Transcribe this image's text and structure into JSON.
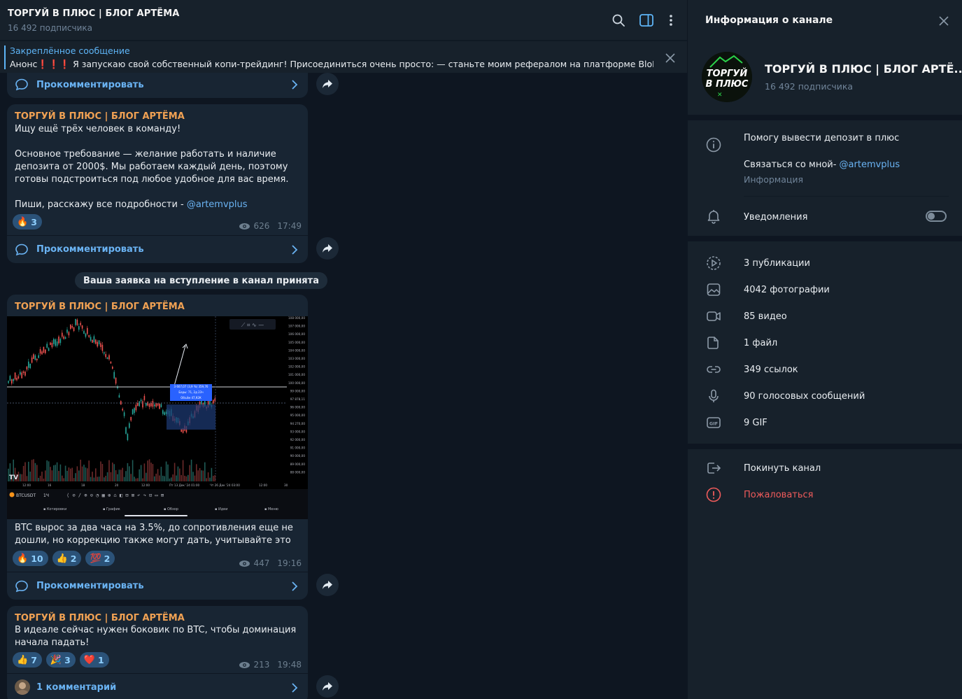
{
  "header": {
    "title": "ТОРГУЙ В ПЛЮС | БЛОГ АРТЁМА",
    "subtitle": "16 492 подписчика"
  },
  "pinned": {
    "title": "Закреплённое сообщение",
    "text": "Анонс❗️❗️❗️ Я запускаю свой собственный копи-трейдинг!  Присоединиться очень просто: — станьте моим рефералом на платформе BloFi..."
  },
  "top_comment": {
    "label": "Прокомментировать"
  },
  "messages": [
    {
      "author": "ТОРГУЙ В ПЛЮС | БЛОГ АРТЁМА",
      "text_main": "Ищу ещё трёх человек в команду!\n\nОсновное требование — желание работать и наличие депозита от 2000$. Мы работаем каждый день, поэтому готовы подстроиться под любое удобное для вас время.\n\nПиши, расскажу все подробности - ",
      "mention": "@artemvplus",
      "reactions": [
        {
          "emoji": "🔥",
          "count": "3"
        }
      ],
      "views": "626",
      "time": "17:49",
      "comment_label": "Прокомментировать"
    },
    {
      "author": "ТОРГУЙ В ПЛЮС | БЛОГ АРТЁМА",
      "chart_caption": {
        "ticker": "BTCUSDT",
        "interval": "1Ч",
        "x_labels": [
          "12:00",
          "16",
          "18",
          "20",
          "12:00",
          "Пт 13 Дек '24  01:00",
          "Чт 26 Дек '24  03:00",
          "12:00",
          "30"
        ],
        "price_labels": [
          "108 000,00",
          "107 000,00",
          "106 000,00",
          "105 000,00",
          "104 000,00",
          "103 000,00",
          "102 000,00",
          "101 000,00",
          "100 000,00",
          "99 000,00",
          "97 878,11",
          "96 000,00",
          "95 000,00",
          "94 270,00",
          "93 000,00",
          "92 000,00",
          "91 000,00",
          "90 000,00",
          "89 000,00",
          "88 000,00"
        ],
        "tooltip": [
          "3 607,07 (3,9 %) 359,76",
          "Бары: 71, 2д 23ч",
          "Объём 47,92К"
        ],
        "bottom_tabs": [
          "Котировки",
          "График",
          "Обзор",
          "Идеи",
          "Меню"
        ]
      },
      "text_main": "BTC вырос за два часа на 3.5%, до сопротивления еще не дошли, но коррекцию также могут дать, учитывайте это",
      "reactions": [
        {
          "emoji": "🔥",
          "count": "10"
        },
        {
          "emoji": "👍",
          "count": "2"
        },
        {
          "emoji": "💯",
          "count": "2"
        }
      ],
      "views": "447",
      "time": "19:16",
      "comment_label": "Прокомментировать"
    },
    {
      "author": "ТОРГУЙ В ПЛЮС | БЛОГ АРТЁМА",
      "text_main": "В идеале сейчас нужен боковик по BTC, чтобы доминация начала падать!",
      "reactions": [
        {
          "emoji": "👍",
          "count": "7"
        },
        {
          "emoji": "🎉",
          "count": "3"
        },
        {
          "emoji": "❤️",
          "count": "1"
        }
      ],
      "views": "213",
      "time": "19:48",
      "comment_label": "1 комментарий"
    }
  ],
  "service_message": "Ваша заявка на вступление в канал принята",
  "panel": {
    "title": "Информация о канале",
    "channel_name": "ТОРГУЙ В ПЛЮС | БЛОГ АРТЁ...",
    "subscribers": "16 492 подписчика",
    "avatar_text_1": "ТОРГУЙ",
    "avatar_text_2": "В ПЛЮС",
    "description": "Помогу вывести депозит в плюс",
    "contact_prefix": "Связаться со мной- ",
    "contact_link": "@artemvplus",
    "info_label": "Информация",
    "notifications_label": "Уведомления",
    "media": [
      {
        "icon": "publications-icon",
        "label": "3 публикации"
      },
      {
        "icon": "photo-icon",
        "label": "4042 фотографии"
      },
      {
        "icon": "video-icon",
        "label": "85 видео"
      },
      {
        "icon": "file-icon",
        "label": "1 файл"
      },
      {
        "icon": "link-icon",
        "label": "349 ссылок"
      },
      {
        "icon": "microphone-icon",
        "label": "90 голосовых сообщений"
      },
      {
        "icon": "gif-icon",
        "label": "9 GIF"
      }
    ],
    "leave_label": "Покинуть канал",
    "report_label": "Пожаловаться"
  },
  "colors": {
    "accent": "#6ab3f3",
    "author": "#f0a153",
    "danger": "#ef5b5b",
    "bg": "#0e1621",
    "panel": "#17212b",
    "bubble": "#182533"
  }
}
